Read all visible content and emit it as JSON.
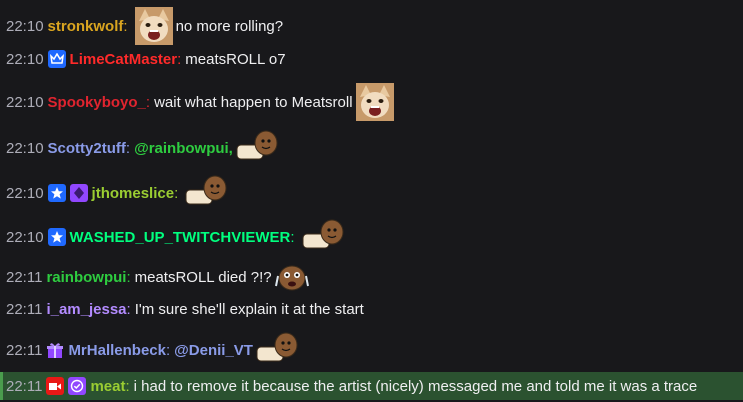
{
  "colors": {
    "background": "#18181b",
    "timestamp": "#adadb8",
    "text": "#efeff1",
    "highlight_background": "#2b5230"
  },
  "messages": [
    {
      "time": "22:10",
      "user": "stronkwolf",
      "user_color": "#daa520",
      "text": "no more rolling?",
      "emote": "cat-emote"
    },
    {
      "time": "22:10",
      "user": "LimeCatMaster",
      "user_color": "#ff2a2a",
      "text": "meatsROLL o7",
      "badges": [
        "prime-crown-badge"
      ]
    },
    {
      "time": "22:10",
      "user": "Spookyboyo_",
      "user_color": "#e0242f",
      "text": "wait what happen to Meatsroll",
      "emote": "cat-emote"
    },
    {
      "time": "22:10",
      "user": "Scotty2tuff",
      "user_color": "#8a9be8",
      "mention": "@rainbowpui,",
      "mention_color": "#2ecc40",
      "emote": "potato-emote"
    },
    {
      "time": "22:10",
      "user": "jthomeslice",
      "user_color": "#9acd32",
      "badges": [
        "star-badge",
        "gem-badge"
      ],
      "emote": "potato-emote"
    },
    {
      "time": "22:10",
      "user": "WASHED_UP_TWITCHVIEWER",
      "user_color": "#00ff7f",
      "badges": [
        "star-badge"
      ],
      "emote": "potato-emote"
    },
    {
      "time": "22:11",
      "user": "rainbowpui",
      "user_color": "#2ecc40",
      "text": "meatsROLL died ?!?",
      "emote": "crying-emote"
    },
    {
      "time": "22:11",
      "user": "i_am_jessa",
      "user_color": "#b38bff",
      "text": "I'm sure she'll explain it at the start"
    },
    {
      "time": "22:11",
      "user": "MrHallenbeck",
      "user_color": "#8a9be8",
      "badges": [
        "gift-badge"
      ],
      "mention": "@Denii_VT",
      "mention_color": "#8a9be8",
      "emote": "potato-emote"
    },
    {
      "time": "22:11",
      "user": "meat",
      "user_color": "#9acd32",
      "badges": [
        "broadcaster-badge",
        "verified-badge"
      ],
      "text": "i had to remove it because the artist (nicely) messaged me and told me it was a trace",
      "highlight": true
    }
  ]
}
